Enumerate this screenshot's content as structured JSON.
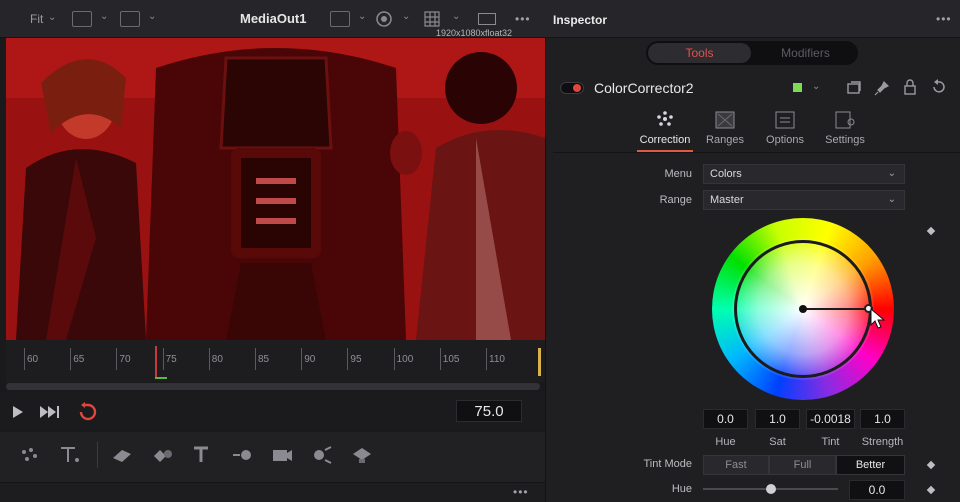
{
  "viewer": {
    "fit_label": "Fit",
    "title": "MediaOut1",
    "resolution": "1920x1080xfloat32",
    "ruler_ticks": [
      "60",
      "65",
      "70",
      "75",
      "80",
      "85",
      "90",
      "95",
      "100",
      "105",
      "110"
    ],
    "current_frame": "75.0",
    "footer_menu": "•••",
    "toolbar_menu": "•••"
  },
  "inspector": {
    "title": "Inspector",
    "header_menu": "•••",
    "tabs": [
      {
        "label": "Tools",
        "active": true
      },
      {
        "label": "Modifiers",
        "active": false
      }
    ],
    "node": {
      "name": "ColorCorrector2",
      "color": "#7ed957"
    },
    "sub_tabs": [
      {
        "label": "Correction",
        "icon": "correction-icon"
      },
      {
        "label": "Ranges",
        "icon": "ranges-icon"
      },
      {
        "label": "Options",
        "icon": "options-icon"
      },
      {
        "label": "Settings",
        "icon": "settings-icon"
      }
    ],
    "menu": {
      "label": "Menu",
      "value": "Colors"
    },
    "range": {
      "label": "Range",
      "value": "Master"
    },
    "wheel_values": [
      {
        "label": "Hue",
        "value": "0.0"
      },
      {
        "label": "Sat",
        "value": "1.0"
      },
      {
        "label": "Tint",
        "value": "-0.0018"
      },
      {
        "label": "Strength",
        "value": "1.0"
      }
    ],
    "tint_mode": {
      "label": "Tint Mode",
      "options": [
        "Fast",
        "Full",
        "Better"
      ],
      "selected": "Better"
    },
    "hue": {
      "label": "Hue",
      "value": "0.0"
    }
  }
}
